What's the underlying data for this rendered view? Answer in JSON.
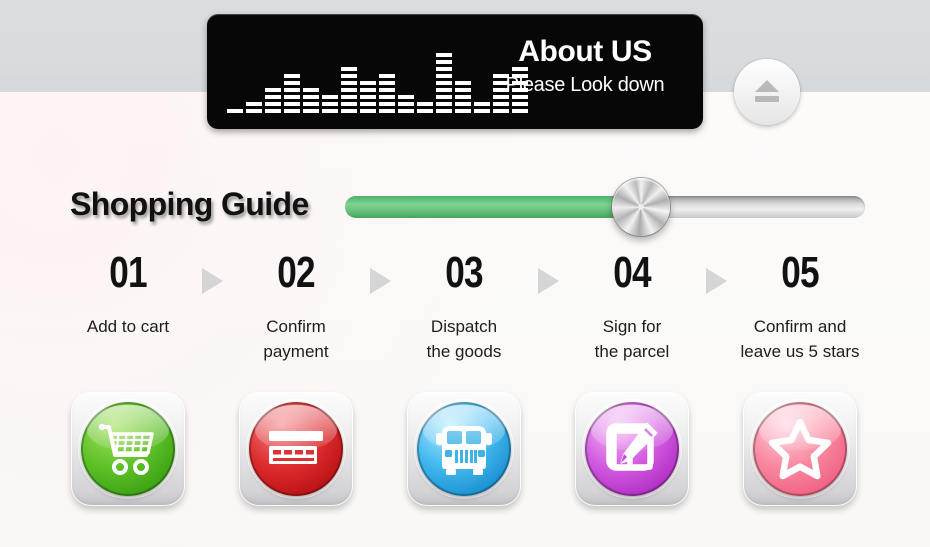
{
  "banner": {
    "title": "About US",
    "subtitle": "Please Look down",
    "equalizer_icon": "audio-equalizer-icon",
    "equalizer_bars": [
      1,
      2,
      4,
      6,
      4,
      3,
      7,
      5,
      6,
      3,
      2,
      9,
      5,
      2,
      6,
      7
    ]
  },
  "eject_button": {
    "icon": "eject-icon",
    "label": "Eject"
  },
  "guide": {
    "title": "Shopping Guide"
  },
  "slider": {
    "value_percent": 57,
    "fill_color": "#6ec484",
    "track_color": "#d8d8d8",
    "knob_icon": "metal-knob-icon"
  },
  "steps": [
    {
      "number": "01",
      "label": "Add to cart",
      "icon": "shopping-cart-icon",
      "disc_class": "disc-green",
      "color": "#5fc229"
    },
    {
      "number": "02",
      "label": "Confirm\npayment",
      "icon": "credit-card-icon",
      "disc_class": "disc-red",
      "color": "#de2d2f"
    },
    {
      "number": "03",
      "label": "Dispatch\nthe goods",
      "icon": "delivery-bus-icon",
      "disc_class": "disc-blue",
      "color": "#43b9ef"
    },
    {
      "number": "04",
      "label": "Sign for\nthe parcel",
      "icon": "sign-pencil-icon",
      "disc_class": "disc-purple",
      "color": "#d25ce0"
    },
    {
      "number": "05",
      "label": "Confirm and\nleave us 5 stars",
      "icon": "star-icon",
      "disc_class": "disc-pink",
      "color": "#f9889f"
    }
  ],
  "arrow_icon": "arrow-right-icon",
  "colors": {
    "band": "#d9dcdf",
    "background": "#fbf9f9",
    "panel": "#070707",
    "arrow": "#d5d5d5"
  }
}
